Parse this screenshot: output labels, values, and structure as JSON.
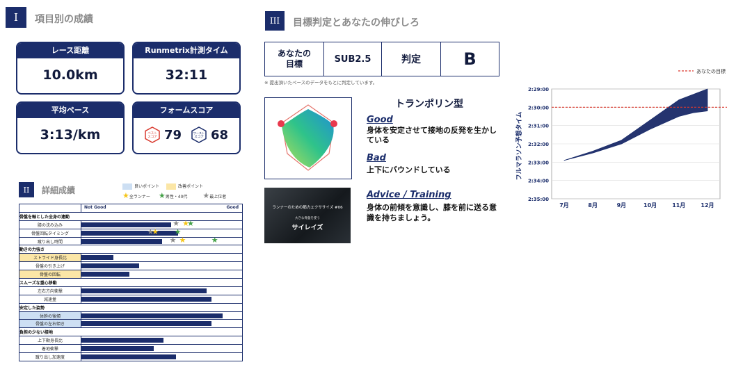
{
  "section1": {
    "badge": "I",
    "title": "項目別の成績"
  },
  "cards": [
    {
      "header": "レース距離",
      "value": "10.0km"
    },
    {
      "header": "Runmetrix計測タイム",
      "value": "32:11"
    },
    {
      "header": "平均ペース",
      "value": "3:13/km"
    },
    {
      "header": "フォームスコア",
      "best_label": "ベスト\nスコア",
      "best": "79",
      "worst_label": "ワースト\nスコア",
      "worst": "68"
    }
  ],
  "section2": {
    "badge": "II",
    "title": "詳細成績"
  },
  "legend": {
    "good": "良いポイント",
    "improve": "改善ポイント",
    "all_runners": "全ランナー",
    "male40": "男性・40代",
    "top": "最上位者",
    "colors": {
      "good": "#cddff3",
      "improve": "#fbe6a6",
      "all": "#f5c518",
      "male": "#43a047",
      "top": "#8a8a8a"
    }
  },
  "detail": {
    "not_good": "Not Good",
    "good": "Good",
    "rows": [
      {
        "type": "group",
        "label": "骨盤を軸とした全身の連動"
      },
      {
        "type": "item",
        "label": "膝の沈み込み",
        "value": 0.56,
        "top": 0.59,
        "all": 0.65,
        "male": 0.68
      },
      {
        "type": "item",
        "label": "骨盤回転タイミング",
        "value": 0.6,
        "top": 0.43,
        "all": 0.46,
        "male": 0.6
      },
      {
        "type": "item",
        "label": "蹴り出し時間",
        "value": 0.5,
        "top": 0.57,
        "all": 0.63,
        "male": 0.83
      },
      {
        "type": "group",
        "label": "動きの力強さ"
      },
      {
        "type": "item",
        "label": "ストライド身長比",
        "value": 0.2,
        "hl": "improve"
      },
      {
        "type": "item",
        "label": "骨盤の引き上げ",
        "value": 0.36
      },
      {
        "type": "item",
        "label": "骨盤の回転",
        "value": 0.3,
        "hl": "improve"
      },
      {
        "type": "group",
        "label": "スムーズな重心移動"
      },
      {
        "type": "item",
        "label": "左右方向衝撃",
        "value": 0.78
      },
      {
        "type": "item",
        "label": "減速量",
        "value": 0.81
      },
      {
        "type": "group",
        "label": "安定した姿勢"
      },
      {
        "type": "item",
        "label": "体幹の後傾",
        "value": 0.88,
        "hl": "good"
      },
      {
        "type": "item",
        "label": "骨盤の左右傾き",
        "value": 0.81,
        "hl": "good"
      },
      {
        "type": "group",
        "label": "負担の少ない接地"
      },
      {
        "type": "item",
        "label": "上下動身長比",
        "value": 0.51
      },
      {
        "type": "item",
        "label": "着地衝撃",
        "value": 0.45
      },
      {
        "type": "item",
        "label": "蹴り出し加速度",
        "value": 0.59
      }
    ]
  },
  "section3": {
    "badge": "III",
    "title": "目標判定とあなたの伸びしろ"
  },
  "judge": {
    "your_goal": "あなたの\n目標",
    "goal": "SUB2.5",
    "verdict_label": "判定",
    "verdict": "B"
  },
  "note": "※ 提出頂いたペースのデータをもとに判定しています。",
  "type_title": "トランポリン型",
  "good_h": "Good",
  "good_t": "身体を安定させて接地の反発を生かしている",
  "bad_h": "Bad",
  "bad_t": "上下にバウンドしている",
  "advice_h": "Advice / Training",
  "advice_t": "身体の前傾を意識し、膝を前に送る意識を持ちましょう。",
  "video": {
    "line1": "ランナーのための筋力エクササイズ #06",
    "line2": "大きな骨盤を使う",
    "line3": "サイレイズ"
  },
  "chart_data": {
    "type": "area",
    "ylabel": "フルマラソン予想タイム",
    "categories": [
      "7月",
      "8月",
      "9月",
      "10月",
      "11月",
      "12月"
    ],
    "y_ticks": [
      "2:29:00",
      "2:30:00",
      "2:31:00",
      "2:32:00",
      "2:33:00",
      "2:34:00",
      "2:35:00"
    ],
    "ylim": [
      149,
      155
    ],
    "target_label": "あなたの目標",
    "target": 150,
    "x": [
      0,
      1,
      2,
      3,
      4,
      4.5,
      5
    ],
    "upper": [
      152.9,
      152.4,
      151.8,
      150.7,
      149.6,
      149.3,
      149.0
    ],
    "lower": [
      152.9,
      152.5,
      152.0,
      151.2,
      150.5,
      150.3,
      150.2
    ],
    "fill": "#25346f",
    "target_color": "#d9392e"
  }
}
